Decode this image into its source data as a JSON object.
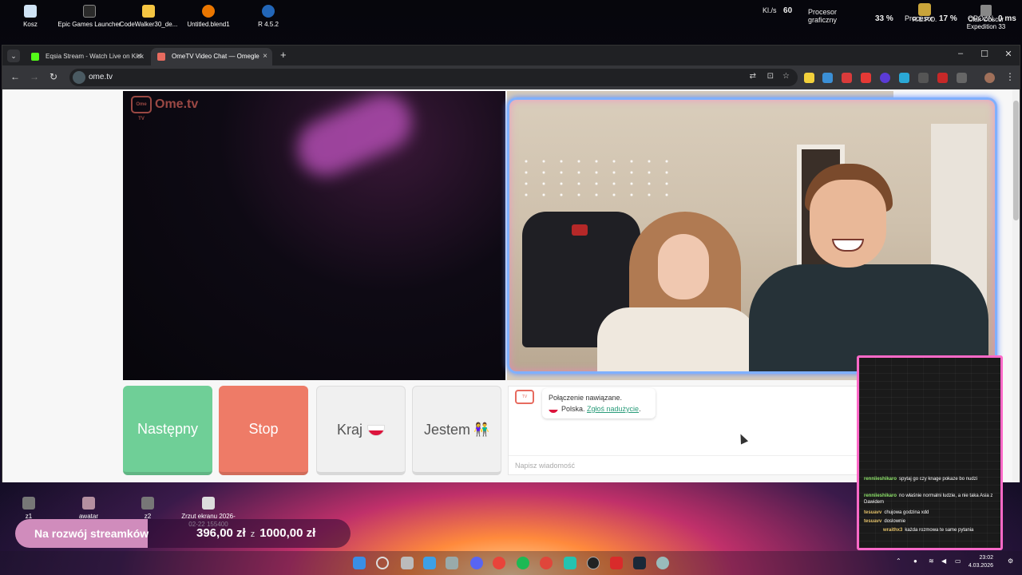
{
  "desktop": {
    "icons": [
      {
        "label": "Kosz",
        "icon": "recycle-bin-icon"
      },
      {
        "label": "Epic Games Launcher",
        "icon": "epic-games-icon"
      },
      {
        "label": "CodeWalker30_de...",
        "icon": "folder-icon"
      },
      {
        "label": "Untitled.blend1",
        "icon": "blender-icon"
      },
      {
        "label": "R 4.5.2",
        "icon": "r-icon"
      }
    ],
    "bottom_icons": [
      {
        "label": "z1",
        "icon": "file-icon"
      },
      {
        "label": "awatar",
        "icon": "image-icon"
      },
      {
        "label": "z2",
        "icon": "file-icon"
      },
      {
        "label": "Zrzut ekranu 2026-02-22 155400",
        "icon": "screenshot-icon"
      }
    ]
  },
  "perf": {
    "fps_label": "Kl./s",
    "fps_value": "60",
    "gpu_label": "Procesor graficzny",
    "gpu_value": "33 %",
    "cpu_label": "Procesor",
    "cpu_value": "17 %",
    "latency_label": "OPÓŹN.",
    "latency_value": "0 ms",
    "game1": "R.E.P.O.",
    "game2": "Clair Obscur Expedition 33"
  },
  "browser": {
    "tabs": [
      {
        "title": "Eqsia Stream - Watch Live on Kick",
        "favicon_color": "#53fc18",
        "active": false
      },
      {
        "title": "OmeTV Video Chat — Omegle",
        "favicon_color": "#e76b5f",
        "active": true
      }
    ],
    "url": "ome.tv"
  },
  "ometv": {
    "logo_text": "Ome.tv",
    "logo_badge": "Ome TV",
    "buttons": {
      "next": "Następny",
      "stop": "Stop",
      "country": "Kraj",
      "gender": "Jestem"
    },
    "chat": {
      "connected": "Połączenie nawiązane.",
      "country": "Polska.",
      "report": "Zgłoś nadużycie",
      "report_suffix": ".",
      "input_placeholder": "Napisz wiadomość"
    }
  },
  "stream_chat": [
    {
      "nick": "renniieshikaro",
      "color": "#8ee36a",
      "text": "spytaj go czy knage pokaze bo nudzi"
    },
    {
      "nick": "renniieshikaro",
      "color": "#8ee36a",
      "text": "no właśnie normalni ludzie, a nie taka Asia z Dawidem"
    },
    {
      "nick": "tesuavv",
      "color": "#e3c16a",
      "text": "chujowa godzina xdd"
    },
    {
      "nick": "tesuavv",
      "color": "#e3c16a",
      "text": "doslownie"
    },
    {
      "nick": "wraithx3",
      "color": "#e3c16a",
      "text": "każda rozmowa te same pytania"
    }
  ],
  "donation": {
    "label": "Na rozwój streamków",
    "current": "396,00 zł",
    "separator": "z",
    "goal": "1000,00 zł",
    "progress_fraction": 0.396
  },
  "clock": {
    "time": "23:02",
    "date": "4.03.2026"
  }
}
